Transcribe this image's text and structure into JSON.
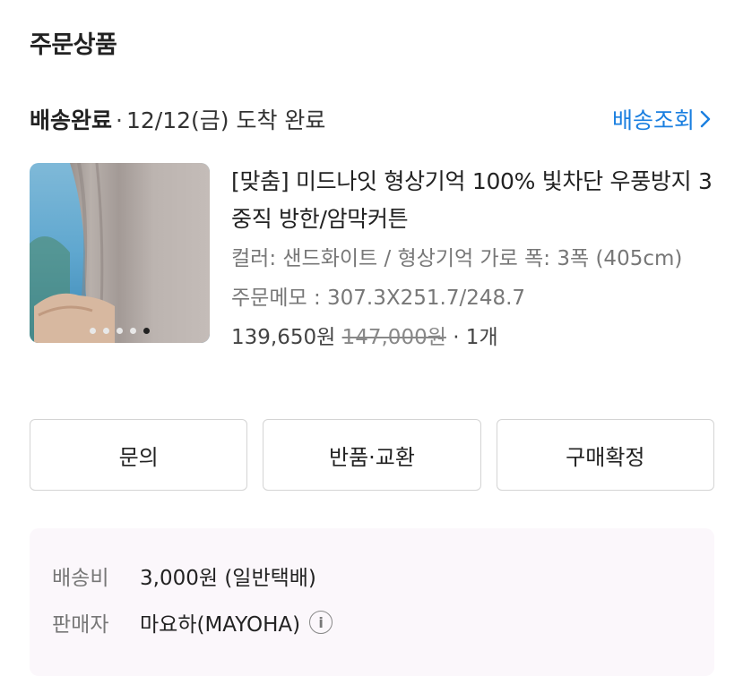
{
  "section": {
    "title": "주문상품"
  },
  "delivery": {
    "status": "배송완료",
    "separator": "·",
    "arrival": "12/12(금) 도착 완료",
    "track_label": "배송조회"
  },
  "thumbnail": {
    "pager_count": 5,
    "pager_active_index": 4
  },
  "product": {
    "name": "[맞춤] 미드나잇 형상기억 100% 빛차단 우풍방지 3중직 방한/암막커튼",
    "option": "컬러: 샌드화이트 / 형상기억 가로 폭: 3폭 (405cm)",
    "memo": "주문메모 : 307.3X251.7/248.7",
    "price": "139,650원",
    "original_price": "147,000원",
    "quantity": "· 1개"
  },
  "actions": [
    {
      "label": "문의"
    },
    {
      "label": "반품·교환"
    },
    {
      "label": "구매확정"
    }
  ],
  "info": {
    "shipping_label": "배송비",
    "shipping_value": "3,000원 (일반택배)",
    "seller_label": "판매자",
    "seller_value": "마요하(MAYOHA)",
    "info_icon": "i"
  },
  "colors": {
    "accent": "#1a7fe0",
    "info_bg": "#fbf7fb"
  }
}
